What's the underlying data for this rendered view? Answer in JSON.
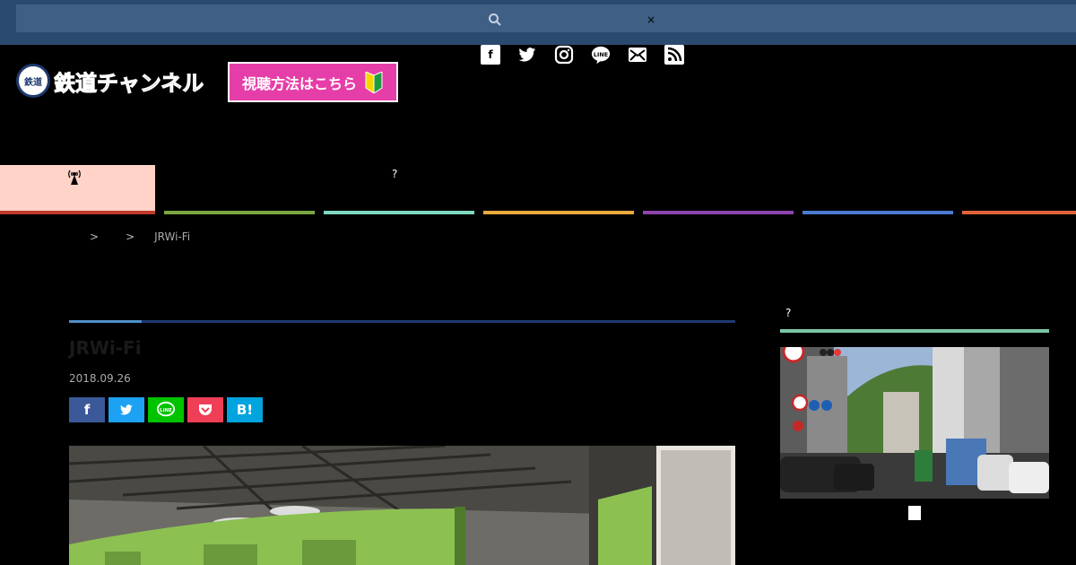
{
  "search": {
    "placeholder": "",
    "clear_label": "×"
  },
  "logo": {
    "badge": "鉄道",
    "text": "鉄道チャンネル"
  },
  "howto_button": {
    "label": "視聴方法はこちら"
  },
  "social": [
    {
      "icon": "facebook-icon",
      "glyph": "f"
    },
    {
      "icon": "twitter-icon",
      "glyph": "t"
    },
    {
      "icon": "instagram-icon",
      "glyph": "◎"
    },
    {
      "icon": "line-icon",
      "glyph": "LINE"
    },
    {
      "icon": "mail-icon",
      "glyph": "✉"
    },
    {
      "icon": "rss-icon",
      "glyph": "))"
    }
  ],
  "nav": {
    "home_icon": "antenna-icon",
    "items_label": "?",
    "colors": [
      "#c0392b",
      "#7aa642",
      "#7fd8c0",
      "#e9a93c",
      "#8e44ad",
      "#4a7bd0",
      "#e0623b"
    ]
  },
  "breadcrumb": {
    "sep1": ">",
    "sep2": ">",
    "current": "JRWi-Fi"
  },
  "article": {
    "title": "JRWi-Fi",
    "date": "2018.09.26"
  },
  "share": [
    {
      "name": "facebook",
      "label": "f",
      "color": "#3b5998"
    },
    {
      "name": "twitter",
      "label": "🐦",
      "color": "#1da1f2"
    },
    {
      "name": "line",
      "label": "LINE",
      "color": "#00c300"
    },
    {
      "name": "pocket",
      "label": "◡",
      "color": "#ef3f56"
    },
    {
      "name": "hatena",
      "label": "B!",
      "color": "#00a4de"
    }
  ],
  "sidebar": {
    "heading": "?"
  }
}
